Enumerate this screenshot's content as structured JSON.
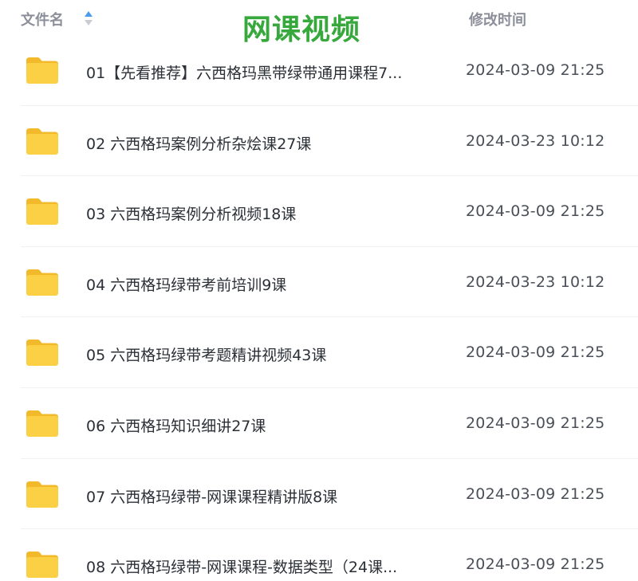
{
  "header": {
    "name_label": "文件名",
    "title": "网课视频",
    "time_label": "修改时间"
  },
  "colors": {
    "title_green": "#37a83c",
    "folder_yellow": "#f9c93a",
    "sort_active": "#4a9cf0"
  },
  "files": [
    {
      "name": "01【先看推荐】六西格玛黑带绿带通用课程7...",
      "time": "2024-03-09 21:25",
      "icon": "folder-icon"
    },
    {
      "name": "02 六西格玛案例分析杂烩课27课",
      "time": "2024-03-23 10:12",
      "icon": "folder-icon"
    },
    {
      "name": "03 六西格玛案例分析视频18课",
      "time": "2024-03-09 21:25",
      "icon": "folder-icon"
    },
    {
      "name": "04 六西格玛绿带考前培训9课",
      "time": "2024-03-23 10:12",
      "icon": "folder-icon"
    },
    {
      "name": "05 六西格玛绿带考题精讲视频43课",
      "time": "2024-03-09 21:25",
      "icon": "folder-icon"
    },
    {
      "name": "06 六西格玛知识细讲27课",
      "time": "2024-03-09 21:25",
      "icon": "folder-icon"
    },
    {
      "name": "07 六西格玛绿带-网课课程精讲版8课",
      "time": "2024-03-09 21:25",
      "icon": "folder-icon"
    },
    {
      "name": "08 六西格玛绿带-网课课程-数据类型（24课...",
      "time": "2024-03-09 21:25",
      "icon": "folder-icon"
    }
  ]
}
